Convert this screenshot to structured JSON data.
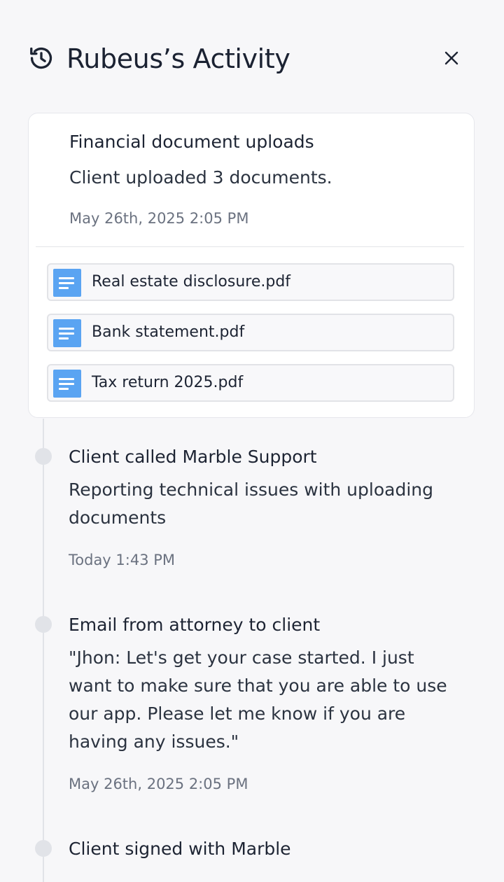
{
  "header": {
    "title": "Rubeus’s Activity",
    "icon": "history-icon",
    "close_icon": "close-icon"
  },
  "card": {
    "title": "Financial document uploads",
    "description": "Client uploaded 3 documents.",
    "timestamp": "May 26th, 2025 2:05 PM",
    "files": [
      {
        "name": "Real estate disclosure.pdf",
        "icon": "document-icon"
      },
      {
        "name": "Bank statement.pdf",
        "icon": "document-icon"
      },
      {
        "name": "Tax return 2025.pdf",
        "icon": "document-icon"
      }
    ]
  },
  "events": [
    {
      "title": "Client called Marble Support",
      "description": "Reporting technical issues with uploading documents",
      "timestamp": "Today 1:43 PM"
    },
    {
      "title": "Email from attorney to client",
      "description": "\"Jhon: Let's get your case started. I just want to make sure that you are able to use our app. Please let me know if you are having any issues.\"",
      "timestamp": "May 26th, 2025 2:05 PM"
    },
    {
      "title": "Client signed with Marble"
    }
  ],
  "colors": {
    "background": "#f7f7f9",
    "card": "#ffffff",
    "file_icon": "#5aa4f2",
    "timeline": "#e1e3e8",
    "text": "#1d2433",
    "muted": "#6b7280"
  }
}
